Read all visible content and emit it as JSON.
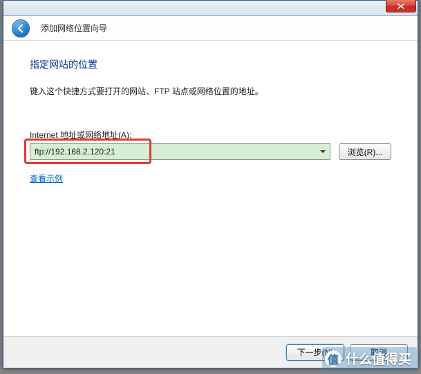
{
  "wizard_title": "添加网络位置向导",
  "heading": "指定网站的位置",
  "instruction": "键入这个快捷方式要打开的网站、FTP 站点或网络位置的地址。",
  "field_label": "Internet 地址或网络地址(A):",
  "address_value": "ftp://192.168.2.120:21",
  "browse_label": "浏览(R)...",
  "example_link": "查看示例",
  "next_label": "下一步(N)",
  "cancel_label": "取消",
  "watermark": "什么值得买"
}
